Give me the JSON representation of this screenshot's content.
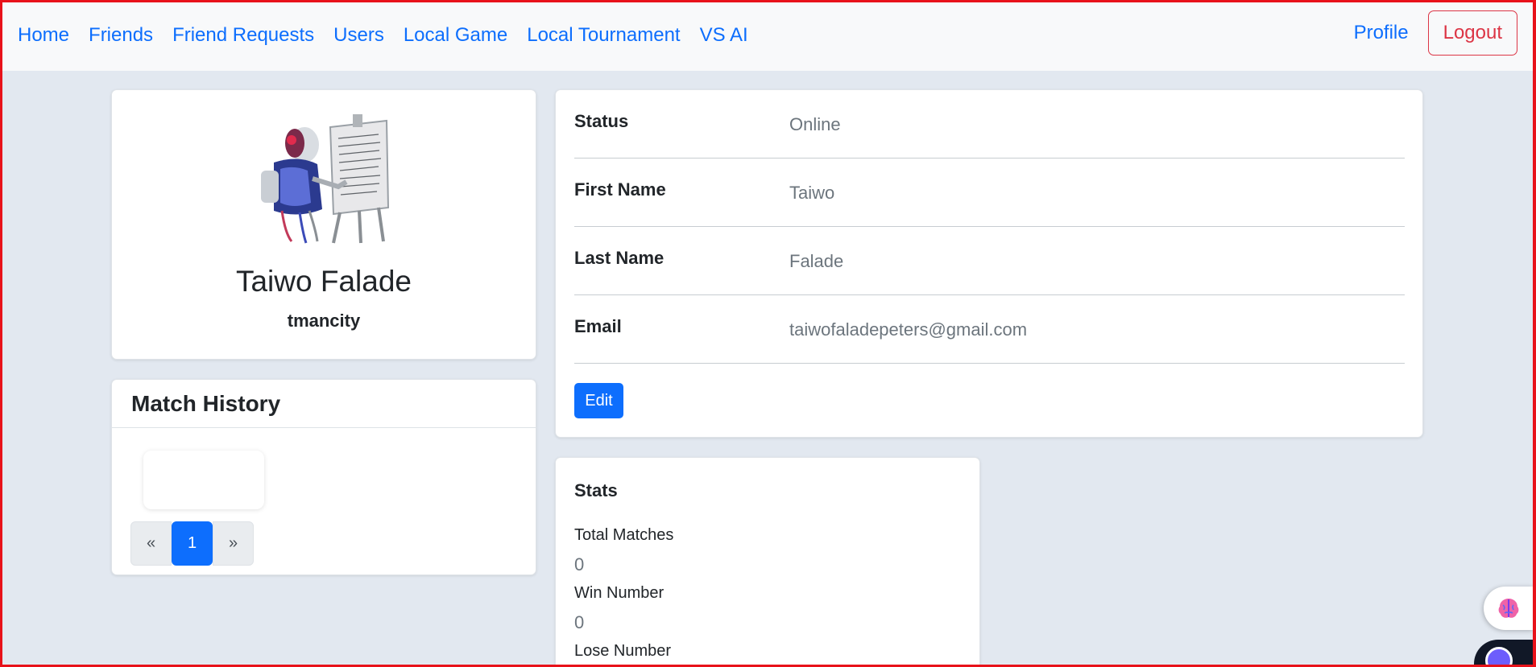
{
  "nav": {
    "links": [
      "Home",
      "Friends",
      "Friend Requests",
      "Users",
      "Local Game",
      "Local Tournament",
      "VS AI"
    ],
    "profile_label": "Profile",
    "logout_label": "Logout"
  },
  "profile": {
    "full_name": "Taiwo Falade",
    "username": "tmancity",
    "avatar_icon": "robot-painting-avatar"
  },
  "match_history": {
    "title": "Match History",
    "pagination": {
      "prev": "«",
      "current": "1",
      "next": "»"
    }
  },
  "details": {
    "rows": [
      {
        "label": "Status",
        "value": "Online"
      },
      {
        "label": "First Name",
        "value": "Taiwo"
      },
      {
        "label": "Last Name",
        "value": "Falade"
      },
      {
        "label": "Email",
        "value": "taiwofaladepeters@gmail.com"
      }
    ],
    "edit_label": "Edit"
  },
  "stats": {
    "title": "Stats",
    "items": [
      {
        "label": "Total Matches",
        "value": "0"
      },
      {
        "label": "Win Number",
        "value": "0"
      },
      {
        "label": "Lose Number",
        "value": ""
      }
    ]
  },
  "colors": {
    "primary": "#0d6efd",
    "danger": "#dc3545",
    "page_bg": "#e2e8f0",
    "frame": "#e8121a"
  }
}
